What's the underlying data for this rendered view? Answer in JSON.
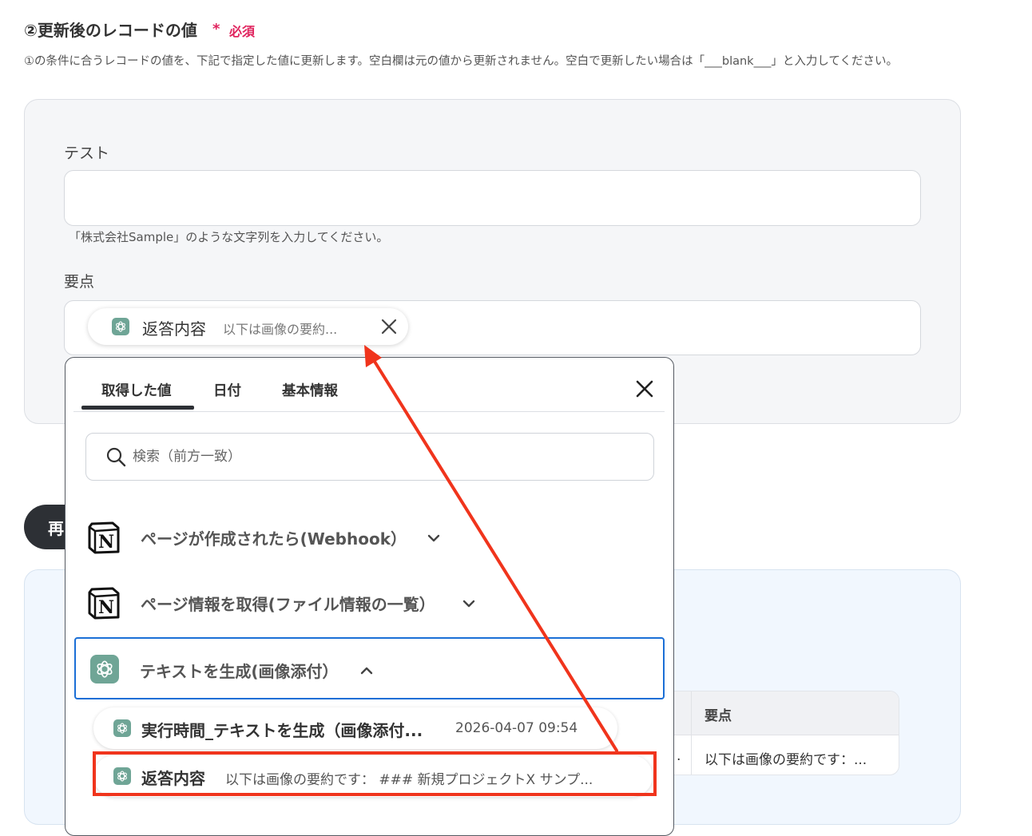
{
  "section": {
    "title": "②更新後のレコードの値",
    "required_mark": "*",
    "required_label": "必須",
    "description": "①の条件に合うレコードの値を、下記で指定した値に更新します。空白欄は元の値から更新されません。空白で更新したい場合は「___blank___」と入力してください。"
  },
  "fields": {
    "test": {
      "label": "テスト",
      "value": "",
      "hint": "「株式会社Sample」のような文字列を入力してください。"
    },
    "points": {
      "label": "要点",
      "chip": {
        "name": "返答内容",
        "preview": "以下は画像の要約..."
      }
    }
  },
  "background": {
    "rerun_button": "再",
    "table": {
      "header": "要点",
      "cell": "以下は画像の要約です：...",
      "cell_prev": "."
    }
  },
  "popover": {
    "tabs": [
      {
        "label": "取得した値",
        "active": true
      },
      {
        "label": "日付",
        "active": false
      },
      {
        "label": "基本情報",
        "active": false
      }
    ],
    "search": {
      "placeholder": "検索（前方一致）",
      "value": ""
    },
    "groups": [
      {
        "label": "ページが作成されたら(Webhook）",
        "icon": "notion-icon",
        "expanded": false
      },
      {
        "label": "ページ情報を取得(ファイル情報の一覧）",
        "icon": "notion-icon",
        "expanded": false
      },
      {
        "label": "テキストを生成(画像添付）",
        "icon": "openai-icon",
        "expanded": true
      }
    ],
    "items": [
      {
        "name": "実行時間_テキストを生成（画像添付...",
        "value": "2026-04-07 09:54"
      },
      {
        "name": "返答内容",
        "value": "以下は画像の要約です： ### 新規プロジェクトX サンプ..."
      }
    ]
  },
  "colors": {
    "required": "#e0245e",
    "selection_border": "#1b6fd6",
    "annotation": "#f0341c",
    "openai_badge": "#6fa596"
  }
}
